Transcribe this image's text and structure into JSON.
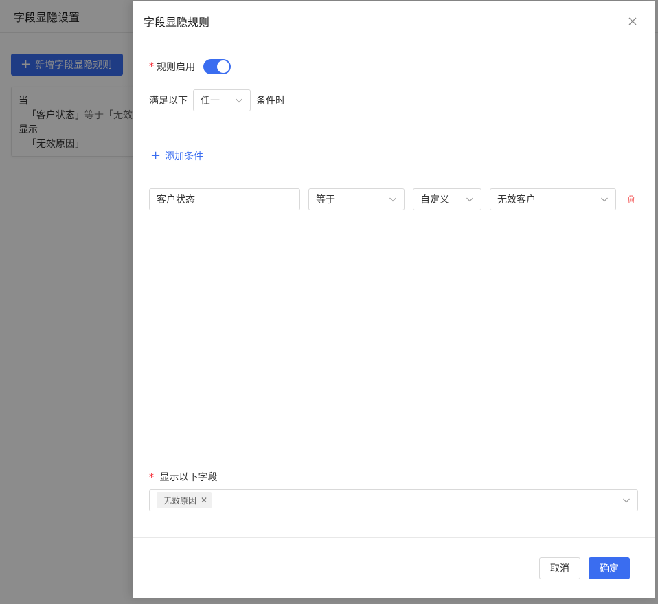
{
  "background": {
    "page_title": "字段显隐设置",
    "add_rule_button": "新增字段显隐规则",
    "card": {
      "line1": "当",
      "line2_a": "「客户状态」",
      "line2_b": "等于「无效",
      "line3": "显示",
      "line4": "「无效原因」"
    }
  },
  "drawer": {
    "title": "字段显隐规则",
    "enable": {
      "label": "规则启用",
      "on": true
    },
    "condition_row": {
      "prefix": "满足以下",
      "match_select": "任一",
      "suffix": "条件时"
    },
    "add_condition": "添加条件",
    "conditions": [
      {
        "field": "客户状态",
        "operator": "等于",
        "mode": "自定义",
        "value": "无效客户"
      }
    ],
    "show_fields": {
      "label": "显示以下字段",
      "tags": [
        "无效原因"
      ]
    },
    "footer": {
      "cancel": "取消",
      "confirm": "确定"
    }
  },
  "colors": {
    "primary": "#3a6df0",
    "danger": "#f5222d"
  },
  "icons": {
    "close": "close-icon",
    "chevron": "chevron-down-icon",
    "trash": "trash-icon",
    "plus": "plus-icon"
  }
}
